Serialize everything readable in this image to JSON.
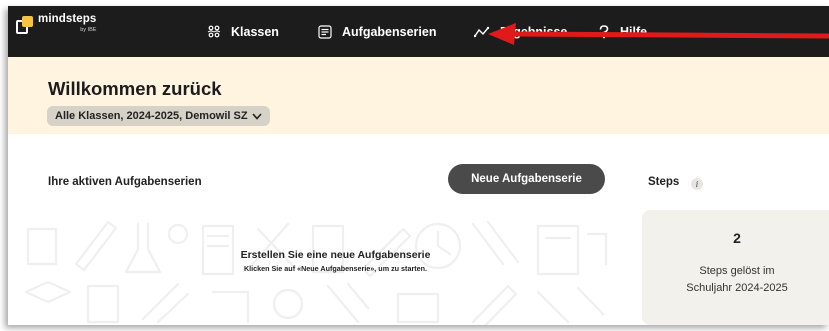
{
  "app": {
    "logo_name": "mindsteps",
    "logo_sub": "by IBE"
  },
  "nav": {
    "items": [
      {
        "label": "Klassen",
        "icon": "people-grid-icon"
      },
      {
        "label": "Aufgabenserien",
        "icon": "list-form-icon"
      },
      {
        "label": "Ergebnisse",
        "icon": "trend-line-icon"
      },
      {
        "label": "Hilfe",
        "icon": "question-icon"
      }
    ]
  },
  "welcome": {
    "title": "Willkommen zurück",
    "class_filter": "Alle Klassen, 2024-2025, Demowil SZ"
  },
  "series": {
    "heading": "Ihre aktiven Aufgabenserien",
    "new_button": "Neue Aufgabenserie",
    "empty_title": "Erstellen Sie eine neue Aufgabenserie",
    "empty_hint": "Klicken Sie auf «Neue Aufgabenserie», um zu starten."
  },
  "steps": {
    "heading": "Steps",
    "info_glyph": "i",
    "count": "2",
    "label_line1": "Steps gelöst im",
    "label_line2": "Schuljahr 2024-2025"
  },
  "colors": {
    "topbar": "#1c1c1c",
    "logo_accent": "#f6c344",
    "welcome_bg": "#fef4e0",
    "button_bg": "#4a4a4a",
    "annotation_arrow": "#e01a1a"
  }
}
